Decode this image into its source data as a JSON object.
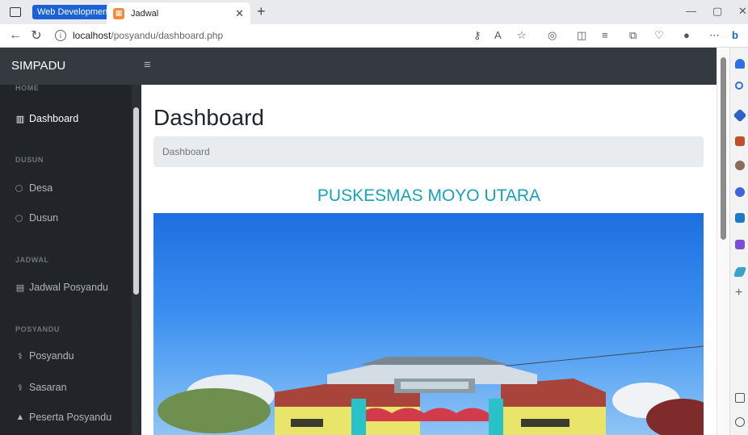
{
  "browser": {
    "tab_group_label": "Web Development",
    "tab_title": "Jadwal",
    "url_host": "localhost",
    "url_path": "/posyandu/dashboard.php"
  },
  "navbar": {
    "brand": "SIMPADU"
  },
  "sidebar": {
    "sections": [
      {
        "heading": "HOME",
        "items": [
          {
            "label": "Dashboard",
            "icon": "building-icon",
            "active": true
          }
        ]
      },
      {
        "heading": "DUSUN",
        "items": [
          {
            "label": "Desa",
            "icon": "circle-icon"
          },
          {
            "label": "Dusun",
            "icon": "circle-icon"
          }
        ]
      },
      {
        "heading": "JADWAL",
        "items": [
          {
            "label": "Jadwal Posyandu",
            "icon": "calendar-icon"
          }
        ]
      },
      {
        "heading": "POSYANDU",
        "items": [
          {
            "label": "Posyandu",
            "icon": "stethoscope-icon"
          },
          {
            "label": "Sasaran",
            "icon": "stethoscope-icon"
          },
          {
            "label": "Peserta Posyandu",
            "icon": "user-icon"
          }
        ]
      }
    ]
  },
  "main": {
    "title": "Dashboard",
    "breadcrumb": "Dashboard",
    "headline": "PUSKESMAS MOYO UTARA"
  },
  "colors": {
    "navbar_bg": "#343a40",
    "sidebar_bg": "#212529",
    "headline": "#17a2b8",
    "breadcrumb_bg": "#e9ecef",
    "tab_group": "#1a62d6"
  }
}
